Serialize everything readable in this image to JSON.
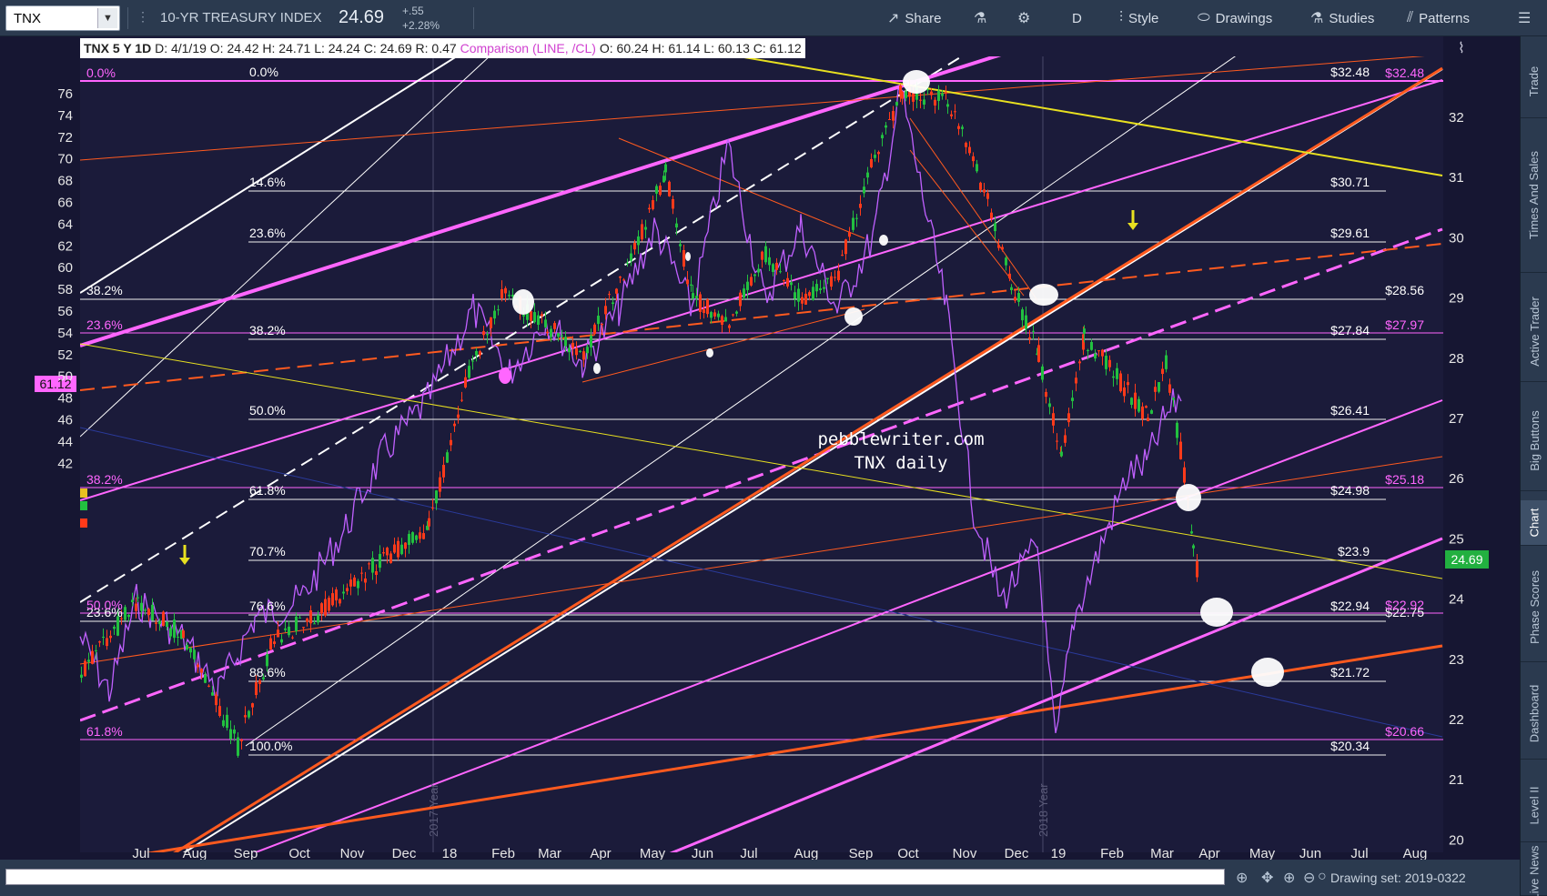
{
  "toolbar": {
    "symbol": "TNX",
    "index_name": "10-YR TREASURY INDEX",
    "last_price": "24.69",
    "change": "+.55",
    "change_pct": "+2.28%",
    "share_label": "Share",
    "period_label": "D",
    "style_label": "Style",
    "drawings_label": "Drawings",
    "studies_label": "Studies",
    "patterns_label": "Patterns"
  },
  "info_bar": {
    "symbol_period": "TNX 5 Y 1D",
    "date": "D: 4/1/19",
    "open": "O: 24.42",
    "high": "H: 24.71",
    "low": "L: 24.24",
    "close": "C: 24.69",
    "ratio": "R: 0.47",
    "comparison": "Comparison (LINE, /CL)",
    "cmp_open": "O: 60.24",
    "cmp_high": "H: 61.14",
    "cmp_low": "L: 60.13",
    "cmp_close": "C: 61.12"
  },
  "watermark": {
    "site": "pebblewriter.com",
    "caption": "TNX daily"
  },
  "axes": {
    "left_ticks": [
      "76",
      "74",
      "72",
      "70",
      "68",
      "66",
      "64",
      "62",
      "60",
      "58",
      "56",
      "54",
      "52",
      "50",
      "48",
      "46",
      "44",
      "42"
    ],
    "right_ticks": [
      "32",
      "31",
      "30",
      "29",
      "28",
      "27",
      "26",
      "25",
      "24",
      "23",
      "22",
      "21",
      "20"
    ],
    "x_ticks": [
      "Jul",
      "Aug",
      "Sep",
      "Oct",
      "Nov",
      "Dec",
      "18",
      "Feb",
      "Mar",
      "Apr",
      "May",
      "Jun",
      "Jul",
      "Aug",
      "Sep",
      "Oct",
      "Nov",
      "Dec",
      "19",
      "Feb",
      "Mar",
      "Apr",
      "May",
      "Jun",
      "Jul",
      "Aug"
    ],
    "year_labels": [
      "2017 Year",
      "2018 Year"
    ],
    "cmp_price_badge": "61.12",
    "last_price_badge": "24.69"
  },
  "fib_levels": {
    "white": [
      {
        "pct": "0.0%",
        "price": "$32.48"
      },
      {
        "pct": "14.6%",
        "price": "$30.71"
      },
      {
        "pct": "23.6%",
        "price": "$29.61"
      },
      {
        "pct": "38.2%",
        "price": "$27.84"
      },
      {
        "pct": "50.0%",
        "price": "$26.41"
      },
      {
        "pct": "61.8%",
        "price": "$24.98"
      },
      {
        "pct": "70.7%",
        "price": "$23.9"
      },
      {
        "pct": "76.6%",
        "price": "$22.94"
      },
      {
        "pct": "88.6%",
        "price": "$21.72"
      },
      {
        "pct": "100.0%",
        "price": "$20.34"
      }
    ],
    "white_left": [
      {
        "pct": "38.2%",
        "price": "$28.56"
      },
      {
        "pct": "23.6%",
        "price": "$22.75"
      }
    ],
    "magenta": [
      {
        "pct": "0.0%",
        "price": "$32.48"
      },
      {
        "pct": "23.6%",
        "price": "$27.97"
      },
      {
        "pct": "38.2%",
        "price": "$25.18"
      },
      {
        "pct": "50.0%",
        "price": "$22.92"
      },
      {
        "pct": "61.8%",
        "price": "$20.66"
      }
    ]
  },
  "sidebar_tabs": [
    "Trade",
    "Times And Sales",
    "Active Trader",
    "Big Buttons",
    "Chart",
    "Phase Scores",
    "Dashboard",
    "Level II",
    "Live News"
  ],
  "bottom": {
    "drawing_set": "Drawing set: 2019-0322"
  },
  "colors": {
    "chart_bg": "#1b1b3a",
    "magenta": "#ff66ff",
    "orange": "#ff5a1f",
    "yellow": "#e8e020",
    "up_candle": "#22c040",
    "down_candle": "#ff3a1a",
    "comparison_line": "#c060ff"
  }
}
